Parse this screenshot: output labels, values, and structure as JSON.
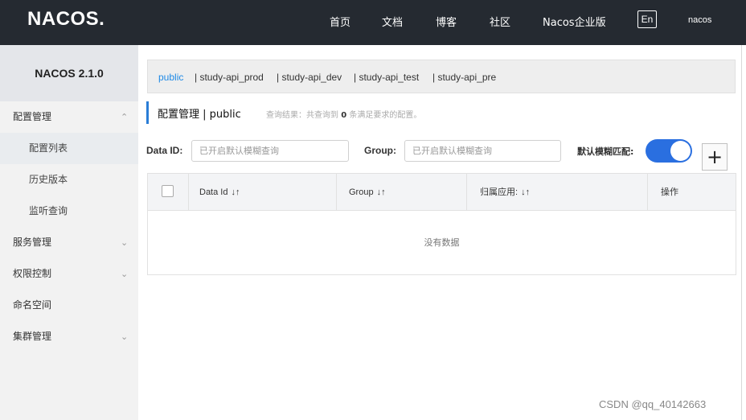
{
  "topbar": {
    "logo": "NACOS.",
    "nav": [
      "首页",
      "文档",
      "博客",
      "社区",
      "Nacos企业版"
    ],
    "lang": "En",
    "user": "nacos"
  },
  "sidebar": {
    "version": "NACOS 2.1.0",
    "items": [
      {
        "label": "配置管理",
        "chevron": "^"
      },
      {
        "label": "配置列表"
      },
      {
        "label": "历史版本"
      },
      {
        "label": "监听查询"
      },
      {
        "label": "服务管理",
        "chevron": "v"
      },
      {
        "label": "权限控制",
        "chevron": "v"
      },
      {
        "label": "命名空间"
      },
      {
        "label": "集群管理",
        "chevron": "v"
      }
    ]
  },
  "namespaces": [
    "public",
    "| study-api_prod",
    "| study-api_dev",
    "| study-api_test",
    "| study-api_pre"
  ],
  "header": {
    "title": "配置管理 | public",
    "query_prefix": "查询结果：共查询到",
    "query_count": "0",
    "query_suffix": "条满足要求的配置。"
  },
  "filters": {
    "data_id_label": "Data ID:",
    "data_id_placeholder": "已开启默认模糊查询",
    "group_label": "Group:",
    "group_placeholder": "已开启默认模糊查询",
    "fuzzy_label": "默认模糊匹配:",
    "fuzzy_on": true,
    "add_symbol": "+"
  },
  "table": {
    "columns": [
      "Data Id",
      "Group",
      "归属应用:",
      "操作"
    ],
    "sort_symbol": "↓↑",
    "empty_text": "没有数据"
  },
  "watermark": "CSDN @qq_40142663",
  "colors": {
    "topbar": "#252a31",
    "accent": "#2a6fe0",
    "active_link": "#1f8ae6"
  }
}
